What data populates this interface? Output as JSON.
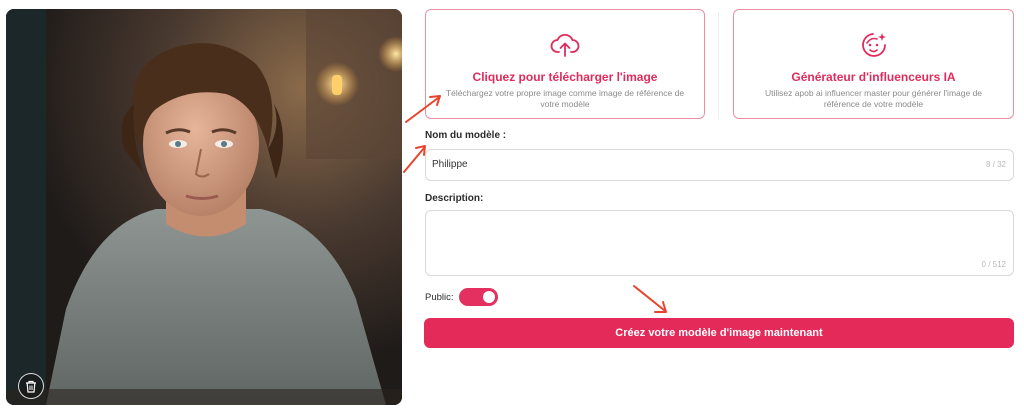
{
  "upload_card": {
    "title": "Cliquez pour télécharger l'image",
    "description": "Téléchargez votre propre image comme image de référence de votre modèle",
    "icon": "cloud-upload-icon"
  },
  "generator_card": {
    "title": "Générateur d'influenceurs IA",
    "description": "Utilisez apob ai influencer master pour générer l'image de référence de votre modèle",
    "icon": "ai-face-icon"
  },
  "model_name": {
    "label": "Nom du modèle :",
    "value": "Philippe",
    "counter": "8 / 32"
  },
  "description_field": {
    "label": "Description:",
    "value": "",
    "counter": "0 / 512"
  },
  "public_toggle": {
    "label": "Public:",
    "on": true
  },
  "create_button": {
    "label": "Créez votre modèle d'image maintenant"
  },
  "colors": {
    "accent": "#e32a59",
    "card_border": "#ee8fa6",
    "annotation_arrow": "#e8452e"
  },
  "photo": {
    "delete_icon": "trash-icon"
  }
}
